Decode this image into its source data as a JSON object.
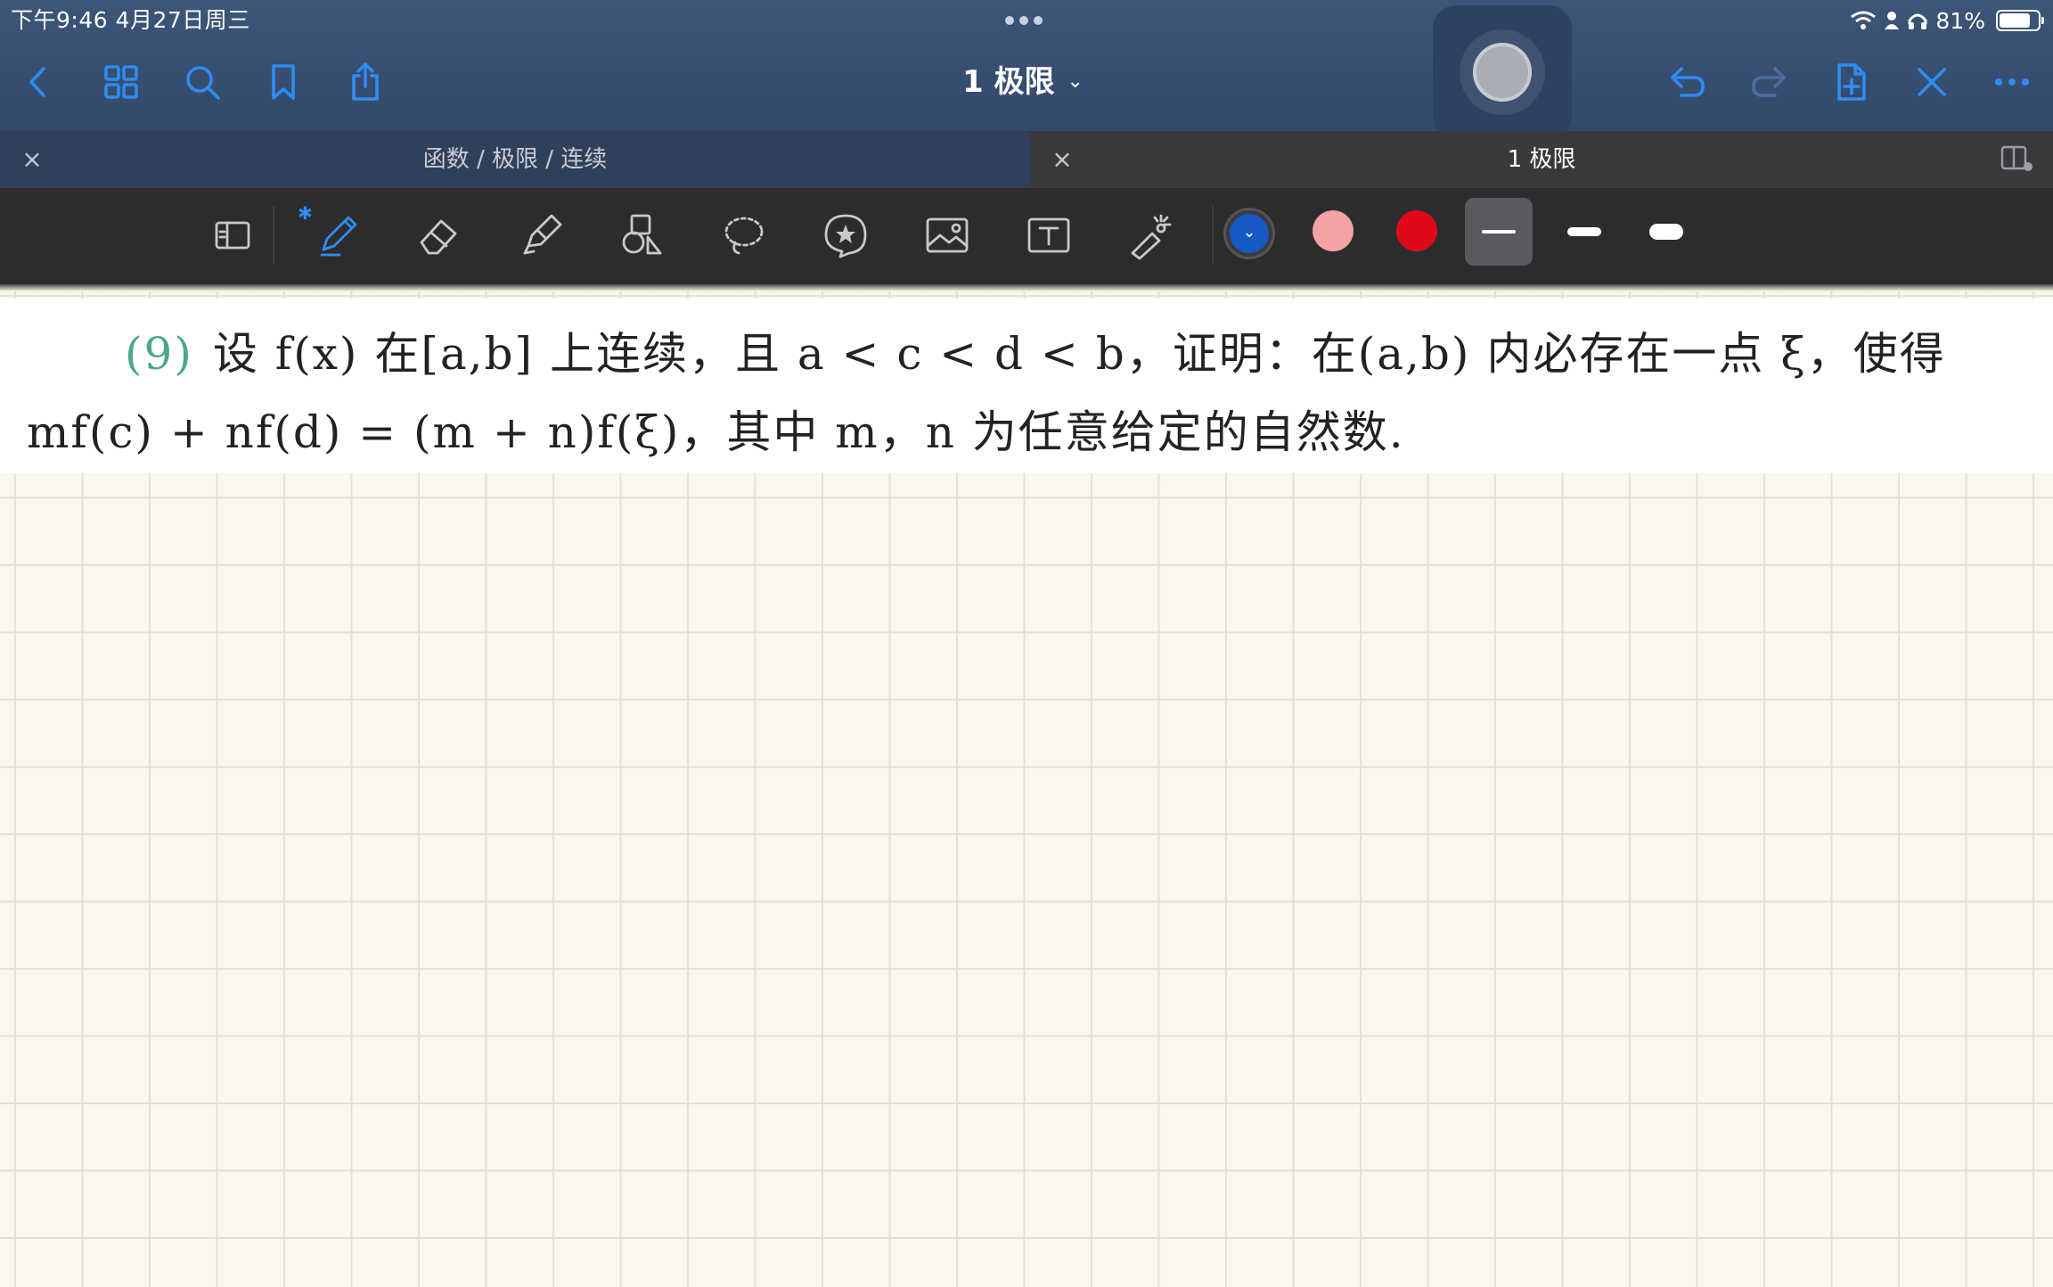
{
  "status_bar": {
    "time_date": "下午9:46   4月27日周三",
    "battery": "81%",
    "battery_level": 0.81
  },
  "header": {
    "title": "1 极限",
    "title_chevron": "⌄"
  },
  "icons": {
    "back": "chevron-left-icon",
    "grid": "grid-icon",
    "search": "search-icon",
    "bookmark": "bookmark-icon",
    "share": "share-icon",
    "undo": "undo-icon",
    "redo": "redo-icon",
    "add_page": "add-page-icon",
    "close": "close-icon",
    "more": "more-icon"
  },
  "tabs": [
    {
      "label": "函数 / 极限 / 连续",
      "close": "×"
    },
    {
      "label": "1 极限",
      "close": "×"
    }
  ],
  "tools": {
    "bluetooth": "✱",
    "colors": [
      "#1559c4",
      "#f5a3a5",
      "#e0081a"
    ],
    "width_options": [
      "thin",
      "medium",
      "thick"
    ],
    "selected_width": "thin",
    "accent": "#2f8cf0"
  },
  "problem": {
    "number": "(9)",
    "line1": "设 f(x) 在[a,b] 上连续，且 a < c < d < b，证明：在(a,b) 内必存在一点 ξ，使得",
    "line2": "mf(c) + nf(d) = (m + n)f(ξ)，其中 m，n 为任意给定的自然数."
  }
}
